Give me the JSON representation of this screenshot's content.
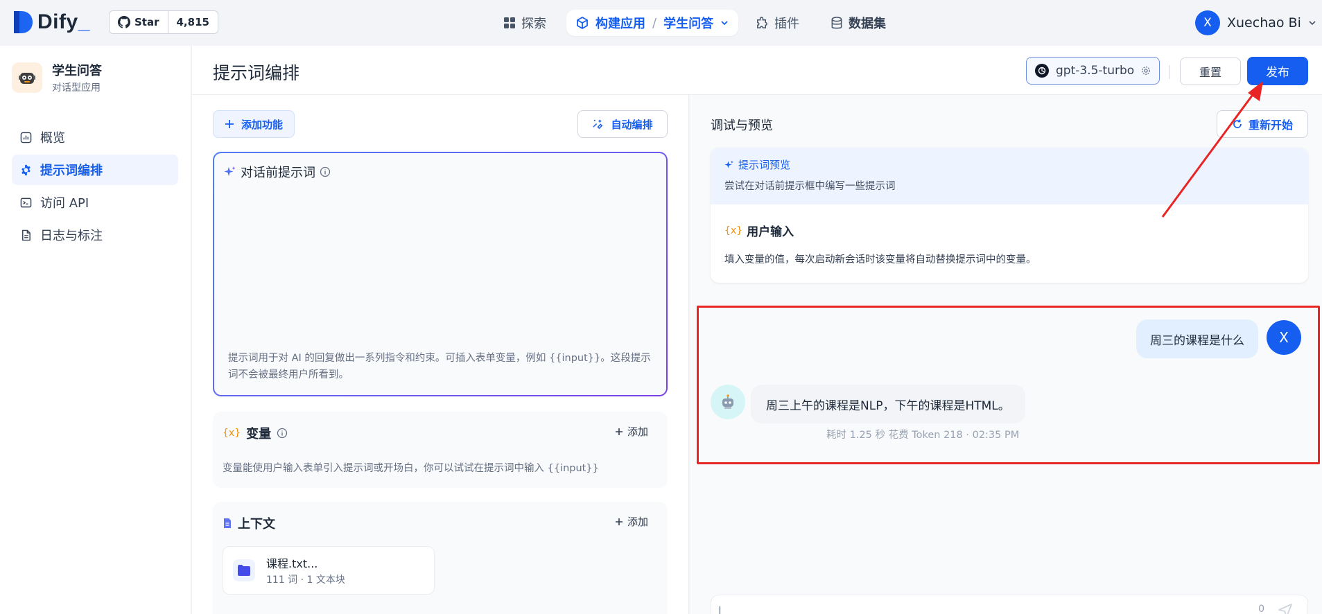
{
  "topnav": {
    "logo_text": "Dify",
    "logo_suffix": "_",
    "github_star_label": "Star",
    "github_star_count": "4,815",
    "explore": "探索",
    "build_app": "构建应用",
    "current_app": "学生问答",
    "plugins": "插件",
    "datasets": "数据集",
    "user_initial": "X",
    "user_name": "Xuechao Bi"
  },
  "sidebar": {
    "app_name": "学生问答",
    "app_type": "对话型应用",
    "items": [
      {
        "label": "概览",
        "icon": "chart-icon",
        "active": false
      },
      {
        "label": "提示词编排",
        "icon": "gear-icon",
        "active": true
      },
      {
        "label": "访问 API",
        "icon": "terminal-icon",
        "active": false
      },
      {
        "label": "日志与标注",
        "icon": "document-icon",
        "active": false
      }
    ]
  },
  "header": {
    "title": "提示词编排",
    "model": "gpt-3.5-turbo",
    "reset": "重置",
    "publish": "发布"
  },
  "editor": {
    "add_feature": "添加功能",
    "auto_arrange": "自动编排",
    "prompt_title": "对话前提示词",
    "prompt_hint": "提示词用于对 AI 的回复做出一系列指令和约束。可插入表单变量，例如 {{input}}。这段提示词不会被最终用户所看到。",
    "variables_title": "变量",
    "variables_add": "添加",
    "variables_desc": "变量能使用户输入表单引入提示词或开场白，你可以试试在提示词中输入 {{input}}",
    "context_title": "上下文",
    "context_add": "添加",
    "context_file_name": "课程.txt...",
    "context_file_meta": "111 词 · 1 文本块"
  },
  "preview": {
    "title": "调试与预览",
    "restart": "重新开始",
    "prompt_preview_label": "提示词预览",
    "prompt_preview_desc": "尝试在对话前提示框中编写一些提示词",
    "user_input_prefix": "{x}",
    "user_input_title": "用户输入",
    "user_input_desc": "填入变量的值，每次启动新会话时该变量将自动替换提示词中的变量。",
    "user_message": "周三的课程是什么",
    "user_initial": "X",
    "bot_message": "周三上午的课程是NLP，下午的课程是HTML。",
    "bot_meta": "耗时 1.25 秒   花费 Token 218  ·   02:35 PM",
    "char_count": "0"
  },
  "colors": {
    "accent": "#155eef",
    "annotation_red": "#e82424"
  }
}
